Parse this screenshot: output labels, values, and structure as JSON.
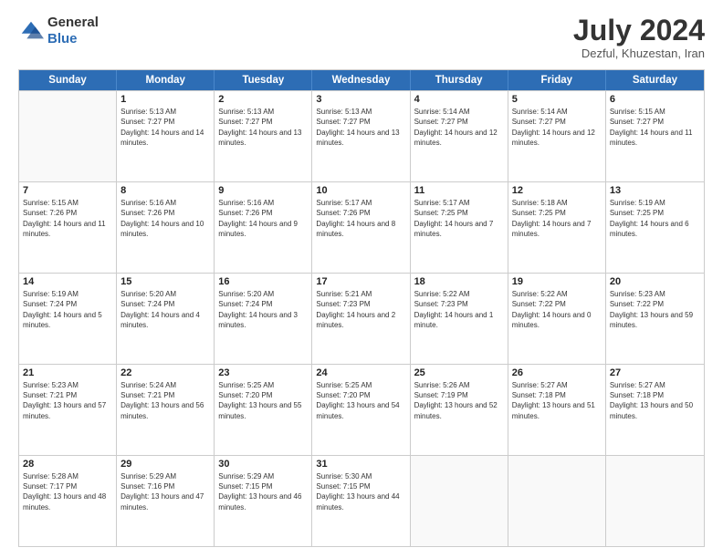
{
  "header": {
    "logo_general": "General",
    "logo_blue": "Blue",
    "month_title": "July 2024",
    "subtitle": "Dezful, Khuzestan, Iran"
  },
  "days_of_week": [
    "Sunday",
    "Monday",
    "Tuesday",
    "Wednesday",
    "Thursday",
    "Friday",
    "Saturday"
  ],
  "weeks": [
    [
      {
        "day": "",
        "empty": true
      },
      {
        "day": "1",
        "sunrise": "5:13 AM",
        "sunset": "7:27 PM",
        "daylight": "14 hours and 14 minutes."
      },
      {
        "day": "2",
        "sunrise": "5:13 AM",
        "sunset": "7:27 PM",
        "daylight": "14 hours and 13 minutes."
      },
      {
        "day": "3",
        "sunrise": "5:13 AM",
        "sunset": "7:27 PM",
        "daylight": "14 hours and 13 minutes."
      },
      {
        "day": "4",
        "sunrise": "5:14 AM",
        "sunset": "7:27 PM",
        "daylight": "14 hours and 12 minutes."
      },
      {
        "day": "5",
        "sunrise": "5:14 AM",
        "sunset": "7:27 PM",
        "daylight": "14 hours and 12 minutes."
      },
      {
        "day": "6",
        "sunrise": "5:15 AM",
        "sunset": "7:27 PM",
        "daylight": "14 hours and 11 minutes."
      }
    ],
    [
      {
        "day": "7",
        "sunrise": "5:15 AM",
        "sunset": "7:26 PM",
        "daylight": "14 hours and 11 minutes."
      },
      {
        "day": "8",
        "sunrise": "5:16 AM",
        "sunset": "7:26 PM",
        "daylight": "14 hours and 10 minutes."
      },
      {
        "day": "9",
        "sunrise": "5:16 AM",
        "sunset": "7:26 PM",
        "daylight": "14 hours and 9 minutes."
      },
      {
        "day": "10",
        "sunrise": "5:17 AM",
        "sunset": "7:26 PM",
        "daylight": "14 hours and 8 minutes."
      },
      {
        "day": "11",
        "sunrise": "5:17 AM",
        "sunset": "7:25 PM",
        "daylight": "14 hours and 7 minutes."
      },
      {
        "day": "12",
        "sunrise": "5:18 AM",
        "sunset": "7:25 PM",
        "daylight": "14 hours and 7 minutes."
      },
      {
        "day": "13",
        "sunrise": "5:19 AM",
        "sunset": "7:25 PM",
        "daylight": "14 hours and 6 minutes."
      }
    ],
    [
      {
        "day": "14",
        "sunrise": "5:19 AM",
        "sunset": "7:24 PM",
        "daylight": "14 hours and 5 minutes."
      },
      {
        "day": "15",
        "sunrise": "5:20 AM",
        "sunset": "7:24 PM",
        "daylight": "14 hours and 4 minutes."
      },
      {
        "day": "16",
        "sunrise": "5:20 AM",
        "sunset": "7:24 PM",
        "daylight": "14 hours and 3 minutes."
      },
      {
        "day": "17",
        "sunrise": "5:21 AM",
        "sunset": "7:23 PM",
        "daylight": "14 hours and 2 minutes."
      },
      {
        "day": "18",
        "sunrise": "5:22 AM",
        "sunset": "7:23 PM",
        "daylight": "14 hours and 1 minute."
      },
      {
        "day": "19",
        "sunrise": "5:22 AM",
        "sunset": "7:22 PM",
        "daylight": "14 hours and 0 minutes."
      },
      {
        "day": "20",
        "sunrise": "5:23 AM",
        "sunset": "7:22 PM",
        "daylight": "13 hours and 59 minutes."
      }
    ],
    [
      {
        "day": "21",
        "sunrise": "5:23 AM",
        "sunset": "7:21 PM",
        "daylight": "13 hours and 57 minutes."
      },
      {
        "day": "22",
        "sunrise": "5:24 AM",
        "sunset": "7:21 PM",
        "daylight": "13 hours and 56 minutes."
      },
      {
        "day": "23",
        "sunrise": "5:25 AM",
        "sunset": "7:20 PM",
        "daylight": "13 hours and 55 minutes."
      },
      {
        "day": "24",
        "sunrise": "5:25 AM",
        "sunset": "7:20 PM",
        "daylight": "13 hours and 54 minutes."
      },
      {
        "day": "25",
        "sunrise": "5:26 AM",
        "sunset": "7:19 PM",
        "daylight": "13 hours and 52 minutes."
      },
      {
        "day": "26",
        "sunrise": "5:27 AM",
        "sunset": "7:18 PM",
        "daylight": "13 hours and 51 minutes."
      },
      {
        "day": "27",
        "sunrise": "5:27 AM",
        "sunset": "7:18 PM",
        "daylight": "13 hours and 50 minutes."
      }
    ],
    [
      {
        "day": "28",
        "sunrise": "5:28 AM",
        "sunset": "7:17 PM",
        "daylight": "13 hours and 48 minutes."
      },
      {
        "day": "29",
        "sunrise": "5:29 AM",
        "sunset": "7:16 PM",
        "daylight": "13 hours and 47 minutes."
      },
      {
        "day": "30",
        "sunrise": "5:29 AM",
        "sunset": "7:15 PM",
        "daylight": "13 hours and 46 minutes."
      },
      {
        "day": "31",
        "sunrise": "5:30 AM",
        "sunset": "7:15 PM",
        "daylight": "13 hours and 44 minutes."
      },
      {
        "day": "",
        "empty": true
      },
      {
        "day": "",
        "empty": true
      },
      {
        "day": "",
        "empty": true
      }
    ]
  ]
}
